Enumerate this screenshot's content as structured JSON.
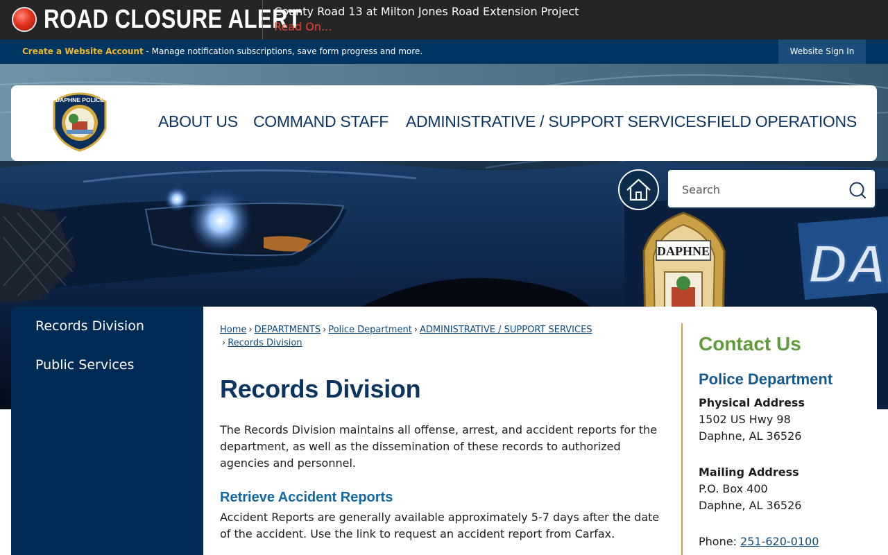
{
  "alert": {
    "title": "ROAD CLOSURE ALERT",
    "headline": "County Road 13 at Milton Jones Road Extension Project",
    "link_label": "Read On..."
  },
  "account_bar": {
    "create_label": "Create a Website Account",
    "description": " - Manage notification subscriptions, save form progress and more.",
    "signin_label": "Website Sign In"
  },
  "logo": {
    "text": "DAPHNE POLICE"
  },
  "nav": {
    "items": [
      {
        "label": "ABOUT US"
      },
      {
        "label": "COMMAND STAFF"
      },
      {
        "label": "ADMINISTRATIVE / SUPPORT SERVICES"
      },
      {
        "label": "FIELD OPERATIONS"
      }
    ]
  },
  "hero": {
    "badge_text": "DAPHNE",
    "car_text": "DAI"
  },
  "search": {
    "placeholder": "Search"
  },
  "sidebar": {
    "items": [
      {
        "label": "Records Division"
      },
      {
        "label": "Public Services"
      }
    ]
  },
  "breadcrumb": {
    "items": [
      {
        "label": "Home"
      },
      {
        "label": "DEPARTMENTS"
      },
      {
        "label": "Police Department"
      },
      {
        "label": "ADMINISTRATIVE / SUPPORT SERVICES"
      },
      {
        "label": "Records Division"
      }
    ],
    "separator": "›"
  },
  "main": {
    "title": "Records Division",
    "intro": "The Records Division maintains all offense, arrest, and accident reports for the department, as well as the dissemination of these records to authorized agencies and personnel.",
    "section_heading": "Retrieve Accident Reports",
    "section_body": "Accident Reports are generally available approximately 5-7 days after the date of the accident. Use the link to request an accident report from Carfax."
  },
  "contact": {
    "title": "Contact Us",
    "department": "Police Department",
    "physical_label": "Physical Address",
    "physical_line1": "1502 US Hwy 98",
    "physical_line2": "Daphne, AL 36526",
    "mailing_label": "Mailing Address",
    "mailing_line1": "P.O. Box 400",
    "mailing_line2": "Daphne, AL 36526",
    "phone_label": "Phone: ",
    "phone": "251-620-0100"
  },
  "colors": {
    "alert_bg": "#252525",
    "alert_red": "#e8452f",
    "account_bar": "#003562",
    "navy": "#0b3560",
    "sidebar": "#002b55",
    "accent_gold": "#c9a33b",
    "contact_green": "#5f9b3c"
  }
}
